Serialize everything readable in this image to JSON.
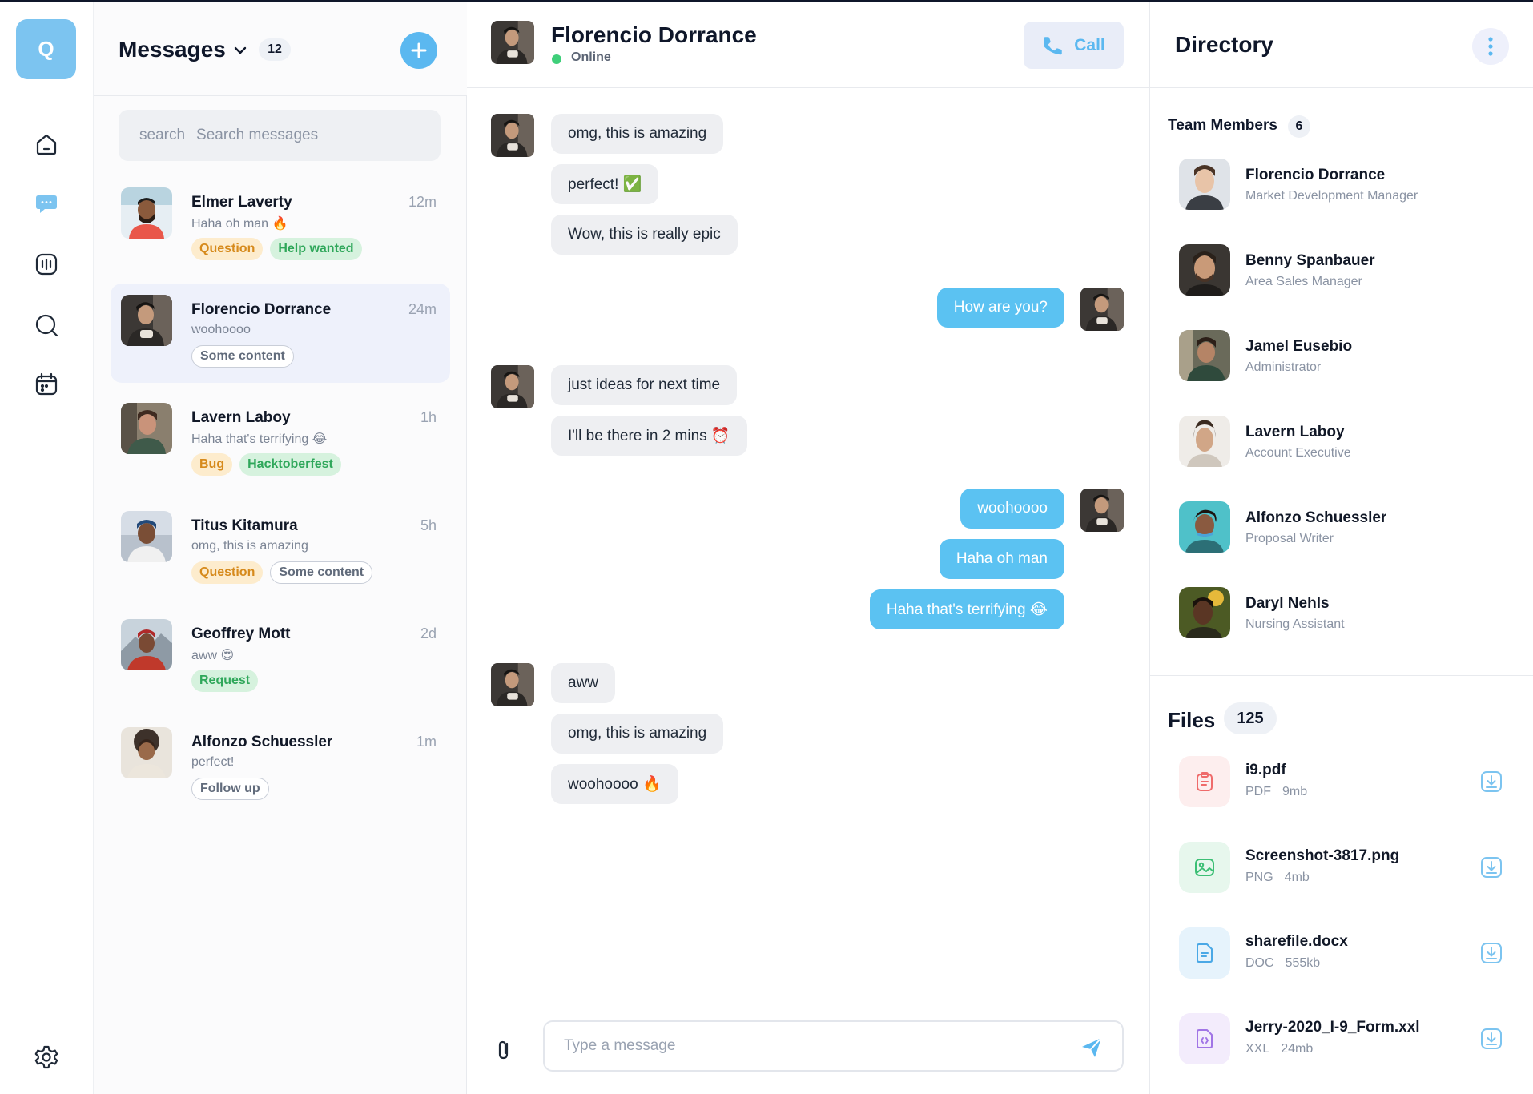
{
  "app": {
    "logo_letter": "Q",
    "accent": "#5bc2f2"
  },
  "rail": {
    "items": [
      {
        "icon": "home-icon"
      },
      {
        "icon": "chat-icon",
        "active": true
      },
      {
        "icon": "stats-icon"
      },
      {
        "icon": "search-icon"
      },
      {
        "icon": "calendar-icon"
      }
    ],
    "bottom": {
      "icon": "gear-icon"
    }
  },
  "messages": {
    "title": "Messages",
    "count": "12",
    "search": {
      "icon_label": "search",
      "placeholder": "Search messages"
    },
    "conversations": [
      {
        "name": "Elmer Laverty",
        "time": "12m",
        "preview": "Haha oh man 🔥",
        "tags": [
          {
            "label": "Question",
            "color": "orange"
          },
          {
            "label": "Help wanted",
            "color": "green"
          }
        ]
      },
      {
        "name": "Florencio Dorrance",
        "time": "24m",
        "preview": "woohoooo",
        "active": true,
        "tags": [
          {
            "label": "Some content",
            "color": "outline"
          }
        ]
      },
      {
        "name": "Lavern Laboy",
        "time": "1h",
        "preview": "Haha that's terrifying 😂",
        "tags": [
          {
            "label": "Bug",
            "color": "orange"
          },
          {
            "label": "Hacktoberfest",
            "color": "green"
          }
        ]
      },
      {
        "name": "Titus Kitamura",
        "time": "5h",
        "preview": "omg, this is amazing",
        "tags": [
          {
            "label": "Question",
            "color": "orange"
          },
          {
            "label": "Some content",
            "color": "outline"
          }
        ]
      },
      {
        "name": "Geoffrey Mott",
        "time": "2d",
        "preview": "aww 😍",
        "tags": [
          {
            "label": "Request",
            "color": "green"
          }
        ]
      },
      {
        "name": "Alfonzo Schuessler",
        "time": "1m",
        "preview": "perfect!",
        "tags": [
          {
            "label": "Follow up",
            "color": "outline"
          }
        ]
      }
    ]
  },
  "chat": {
    "contact": {
      "name": "Florencio Dorrance",
      "status": "Online"
    },
    "call_label": "Call",
    "messages": [
      {
        "dir": "in",
        "text": "omg, this is amazing"
      },
      {
        "dir": "in",
        "text": "perfect! ✅"
      },
      {
        "dir": "in",
        "text": "Wow, this is really epic"
      },
      {
        "dir": "out",
        "text": "How are you?"
      },
      {
        "dir": "in",
        "text": "just ideas for next time"
      },
      {
        "dir": "in",
        "text": "I'll be there in 2 mins ⏰"
      },
      {
        "dir": "out",
        "text": "woohoooo"
      },
      {
        "dir": "out",
        "text": "Haha oh man"
      },
      {
        "dir": "out",
        "text": "Haha that's terrifying 😂"
      },
      {
        "dir": "in",
        "text": "aww"
      },
      {
        "dir": "in",
        "text": "omg, this is amazing"
      },
      {
        "dir": "in",
        "text": "woohoooo 🔥"
      }
    ],
    "composer": {
      "placeholder": "Type a message"
    }
  },
  "directory": {
    "title": "Directory",
    "team_label": "Team Members",
    "team_count": "6",
    "members": [
      {
        "name": "Florencio Dorrance",
        "role": "Market Development Manager"
      },
      {
        "name": "Benny Spanbauer",
        "role": "Area Sales Manager"
      },
      {
        "name": "Jamel Eusebio",
        "role": "Administrator"
      },
      {
        "name": "Lavern Laboy",
        "role": "Account Executive"
      },
      {
        "name": "Alfonzo Schuessler",
        "role": "Proposal Writer"
      },
      {
        "name": "Daryl Nehls",
        "role": "Nursing Assistant"
      }
    ],
    "files_label": "Files",
    "files_count": "125",
    "files": [
      {
        "name": "i9.pdf",
        "type": "PDF",
        "size": "9mb",
        "icon": "pdf-file-icon",
        "color": "#ef6b6b",
        "bg": "#fdeeee"
      },
      {
        "name": "Screenshot-3817.png",
        "type": "PNG",
        "size": "4mb",
        "icon": "image-file-icon",
        "color": "#3cbf75",
        "bg": "#e7f7ed"
      },
      {
        "name": "sharefile.docx",
        "type": "DOC",
        "size": "555kb",
        "icon": "doc-file-icon",
        "color": "#4aa8e6",
        "bg": "#e6f3fc"
      },
      {
        "name": "Jerry-2020_I-9_Form.xxl",
        "type": "XXL",
        "size": "24mb",
        "icon": "code-file-icon",
        "color": "#a175e6",
        "bg": "#f3ecfc"
      }
    ]
  }
}
